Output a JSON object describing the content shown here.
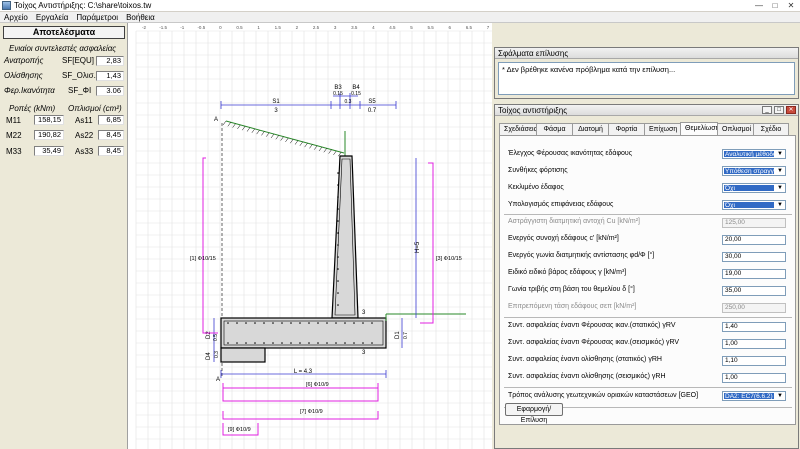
{
  "window": {
    "title": "Τοίχος Αντιστήριξης: C:\\share\\toixos.tw"
  },
  "menu": [
    "Αρχείο",
    "Εργαλεία",
    "Παράμετροι",
    "Βοήθεια"
  ],
  "left": {
    "results_button": "Αποτελέσματα",
    "safety_heading": "Ενιαίοι συντελεστές ασφαλείας",
    "safety": [
      {
        "name": "Ανατροπής",
        "code": "SF[EQU]",
        "value": "2,83"
      },
      {
        "name": "Ολίσθησης",
        "code": "SF_Ολισ.",
        "value": "1,43"
      },
      {
        "name": "Φερ.Ικανότητα",
        "code": "SF_ΦΙ",
        "value": "3.06"
      }
    ],
    "moments_heading": "Ροπές (kNm)",
    "rebar_heading": "Οπλισμοί (cm²)",
    "rows": [
      {
        "m": "M11",
        "mv": "158,15",
        "a": "As11",
        "av": "6,85"
      },
      {
        "m": "M22",
        "mv": "190,82",
        "a": "As22",
        "av": "8,45"
      },
      {
        "m": "M33",
        "mv": "35,49",
        "a": "As33",
        "av": "8,45"
      }
    ]
  },
  "drawing": {
    "ruler_labels": [
      "-2",
      "-1.5",
      "-1",
      "-0.5",
      "0",
      "0.5",
      "1",
      "1.5",
      "2",
      "2.5",
      "3",
      "3.5",
      "4",
      "4.5",
      "5",
      "5.5",
      "6",
      "6.5",
      "7"
    ],
    "labels": {
      "s1": "S1",
      "s1v": "3",
      "b3": "B3",
      "b3v": "0.15",
      "b3b": "0.3",
      "b4": "B4",
      "b4v": "0.15",
      "s5": "S5",
      "s5v": "0.7",
      "a_top": "A",
      "a_bot": "A",
      "r1": "[1] Φ10/15",
      "r3": "[3] Φ10/15",
      "h": "H=5",
      "d1": "D1",
      "d1v": "0.7",
      "d2": "D2",
      "d2v": "0.5",
      "d3": "0.3",
      "d4": "D4",
      "t3a": "3",
      "t3b": "3",
      "l": "L = 4.3",
      "r6": "[6] Φ10/9",
      "r7": "[7] Φ10/9",
      "r9": "[9] Φ10/9"
    }
  },
  "errors": {
    "title": "Σφάλματα επίλυσης",
    "message": "* Δεν βρέθηκε κανένα πρόβλημα κατά την επίλυση..."
  },
  "props": {
    "title": "Τοίχος αντιστήριξης",
    "tabs": [
      "Σχεδιάσεις",
      "Φάσμα",
      "Διατομή",
      "Φορτία",
      "Επίχωση",
      "Θεμελίωση",
      "Οπλισμοί",
      "Σχέδιο"
    ],
    "active_tab": 5,
    "combos": [
      {
        "label": "Έλεγχος Φέρουσας ικανότητας εδάφους",
        "value": "Αναλυτική μέθοδος"
      },
      {
        "label": "Συνθήκες φόρτισης",
        "value": "Υπόθεση στραγγισμένης"
      },
      {
        "label": "Κεκλιμένο έδαφος",
        "value": "Όχι"
      },
      {
        "label": "Υπολογισμός επιφάνειας εδάφους",
        "value": "Όχι"
      }
    ],
    "fields": [
      {
        "label": "Αστράγγιστη διατμητική αντοχή Cu [kN/m²]",
        "value": "125,00",
        "disabled": true
      },
      {
        "label": "Ενεργός συνοχή εδάφους c' [kN/m²]",
        "value": "20,00",
        "disabled": false
      },
      {
        "label": "Ενεργός γωνία διατμητικής αντίστασης φd/Φ [°]",
        "value": "30,00",
        "disabled": false
      },
      {
        "label": "Ειδικό ειδικό βάρος εδάφους γ [kN/m³]",
        "value": "19,00",
        "disabled": false
      },
      {
        "label": "Γωνία τριβής στη βάση του θεμελίου δ [°]",
        "value": "35,00",
        "disabled": false
      },
      {
        "label": "Επιτρεπόμενη τάση εδάφους σεπ [kN/m²]",
        "value": "250,00",
        "disabled": true
      }
    ],
    "factors": [
      {
        "label": "Συντ. ασφαλείας έναντι Φέρουσας ικαν.(στατικός) γRV",
        "value": "1,40"
      },
      {
        "label": "Συντ. ασφαλείας έναντι Φέρουσας ικαν.(σεισμικός) γRV",
        "value": "1,00"
      },
      {
        "label": "Συντ. ασφαλείας έναντι ολίσθησης (στατικός) γRH",
        "value": "1,10"
      },
      {
        "label": "Συντ. ασφαλείας έναντι ολίσθησης (σεισμικός) γRH",
        "value": "1,00"
      }
    ],
    "geo": {
      "label": "Τρόπος ανάλυσης γεωτεχνικών οριακών καταστάσεων [GEO]",
      "value": "DA2: EC7(6.6.2)"
    },
    "apply_button": "Εφαρμογή/Επίλυση"
  }
}
